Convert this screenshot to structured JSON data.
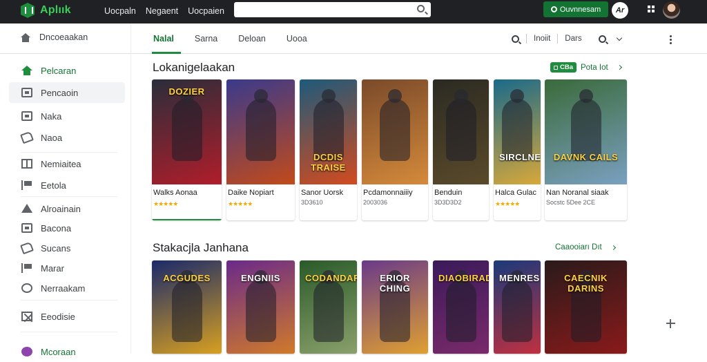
{
  "topbar": {
    "logo": "Aplıık",
    "nav": [
      "Uocpaln",
      "Negaent",
      "Uocpaien"
    ],
    "search_placeholder": "",
    "cta": "Ouvnnesam",
    "user_glyph": "Ar"
  },
  "breadcrumb": {
    "label": "Dncoeaakan"
  },
  "tabs": [
    {
      "label": "Nalal",
      "active": true
    },
    {
      "label": "Sarna"
    },
    {
      "label": "Deloan"
    },
    {
      "label": "Uooa"
    }
  ],
  "tools": {
    "item1": "Inoiit",
    "item2": "Dars"
  },
  "sidebar": {
    "items": [
      {
        "label": "Pelcaran",
        "icon": "home-icon",
        "active": true
      },
      {
        "label": "Pencaoin",
        "icon": "box-icon",
        "selected": true
      },
      {
        "label": "Naka",
        "icon": "box-icon"
      },
      {
        "label": "Naoa",
        "icon": "tag-icon"
      },
      {
        "label": "Nemiaitea",
        "icon": "grid-icon"
      },
      {
        "label": "Eetola",
        "icon": "flag-icon"
      },
      {
        "label": "Alroainain",
        "icon": "triangle-icon"
      },
      {
        "label": "Bacona",
        "icon": "box-icon"
      },
      {
        "label": "Sucans",
        "icon": "tag-icon"
      },
      {
        "label": "Marar",
        "icon": "flag-icon"
      },
      {
        "label": "Nerraakam",
        "icon": "clock-icon"
      },
      {
        "label": "Eeodisie",
        "icon": "x-icon"
      },
      {
        "label": "Mcoraan",
        "icon": "circle-icon"
      }
    ]
  },
  "section1": {
    "title": "Lokanigelaakan",
    "badge": "CBa",
    "link": "Pota Iot",
    "cards": [
      {
        "title_art": "DOZIER",
        "name": "Walks Aonaa",
        "stars": "★★★★★",
        "colors": [
          "#2a2d3a",
          "#b11d2a"
        ]
      },
      {
        "title_art": "",
        "name": "Daike Nopiart",
        "stars": "★★★★★",
        "colors": [
          "#3a3a8c",
          "#c24a1a"
        ]
      },
      {
        "title_art": "DCDIS TRAISE",
        "name": "Sanor Uorsk",
        "meta": "3D3610",
        "colors": [
          "#1d5a7a",
          "#d24b1f"
        ]
      },
      {
        "title_art": "",
        "name": "Pcdamonnaiiiy",
        "meta": "2003036",
        "colors": [
          "#7a4a2a",
          "#d58a3a"
        ]
      },
      {
        "title_art": "",
        "name": "Benduin",
        "meta": "3D3D3D2",
        "colors": [
          "#2b2a22",
          "#5a4a2a"
        ]
      },
      {
        "title_art": "SIRCLNEAD",
        "name": "Halca Gulac",
        "stars": "★★★★★",
        "colors": [
          "#1a6a8a",
          "#d8a83a"
        ]
      },
      {
        "title_art": "DAVNK CAILS",
        "name": "Nan Noranal siaak",
        "meta": "Socstc 5Dee 2CE",
        "colors": [
          "#3a6a3a",
          "#7aa0c0"
        ]
      }
    ]
  },
  "section2": {
    "title": "Stakacjla Janhana",
    "link": "Caaooiarı Dıt",
    "cards": [
      {
        "title_art": "ACGUDES",
        "colors": [
          "#1a2a6a",
          "#d8a020"
        ]
      },
      {
        "title_art": "ENGNIIS",
        "colors": [
          "#6a2a8a",
          "#d07a2a"
        ]
      },
      {
        "title_art": "CODANDARS",
        "colors": [
          "#2a5a2a",
          "#8aa06a"
        ]
      },
      {
        "title_art": "ERIOR CHING",
        "colors": [
          "#6a3a8a",
          "#e0a030"
        ]
      },
      {
        "title_art": "DIAOBIRADE",
        "colors": [
          "#3a1a5a",
          "#7a2a6a"
        ]
      },
      {
        "title_art": "MENRES",
        "colors": [
          "#1a3a7a",
          "#c03040"
        ]
      },
      {
        "title_art": "CAECNIK DARINS",
        "colors": [
          "#2a1a1a",
          "#8a1a1a"
        ]
      }
    ]
  }
}
